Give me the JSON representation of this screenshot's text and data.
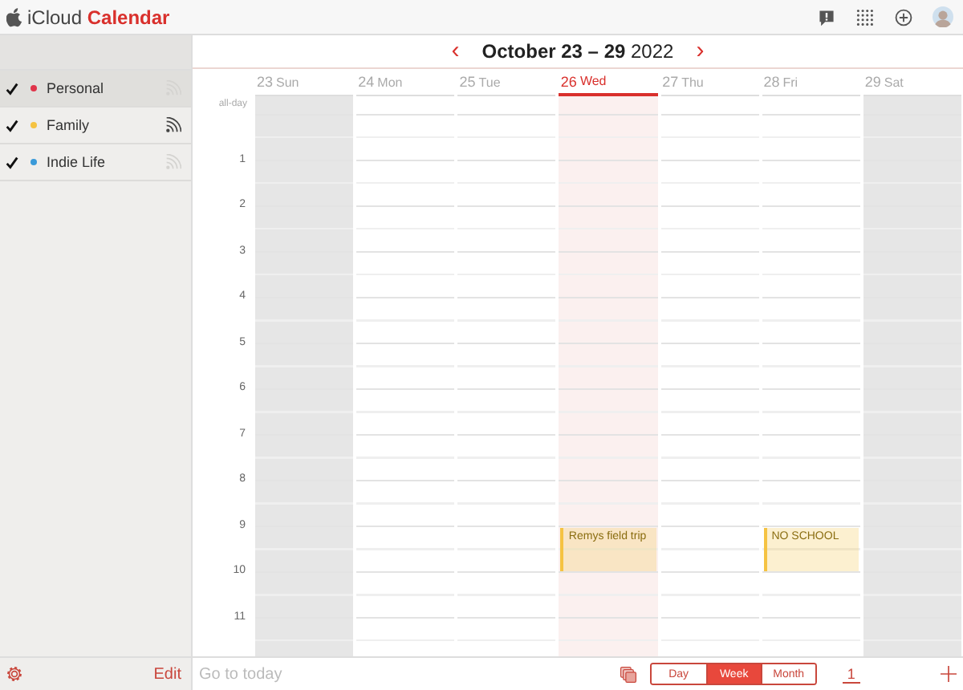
{
  "app": {
    "brand": "iCloud",
    "product": "Calendar"
  },
  "calendars": [
    {
      "name": "Personal",
      "checked": true,
      "selected": true,
      "color": "#e0344a",
      "shared": false
    },
    {
      "name": "Family",
      "checked": true,
      "selected": false,
      "color": "#f5c342",
      "shared": true
    },
    {
      "name": "Indie Life",
      "checked": true,
      "selected": false,
      "color": "#3a9ad9",
      "shared": false
    }
  ],
  "nav": {
    "prev": "‹",
    "title": "**October 23 – 29** 2022",
    "next": "›"
  },
  "all_day_label": "all-day",
  "days": [
    {
      "number": "23",
      "name": "Sun",
      "today": false,
      "weekend": true
    },
    {
      "number": "24",
      "name": "Mon",
      "today": false,
      "weekend": false
    },
    {
      "number": "25",
      "name": "Tue",
      "today": false,
      "weekend": false
    },
    {
      "number": "26",
      "name": "Wed",
      "today": true,
      "weekend": false
    },
    {
      "number": "27",
      "name": "Thu",
      "today": false,
      "weekend": false
    },
    {
      "number": "28",
      "name": "Fri",
      "today": false,
      "weekend": false
    },
    {
      "number": "29",
      "name": "Sat",
      "today": false,
      "weekend": true
    }
  ],
  "hours": [
    {
      "label": "1"
    },
    {
      "label": "2"
    },
    {
      "label": "3"
    },
    {
      "label": "4"
    },
    {
      "label": "5"
    },
    {
      "label": "6"
    },
    {
      "label": "7"
    },
    {
      "label": "8"
    },
    {
      "label": "9",
      "slots": [
        {
          "kind": "empty"
        },
        {
          "kind": "empty"
        },
        {
          "kind": "empty"
        },
        {
          "kind": "event",
          "title": "Remys field trip",
          "color": "#f5c342"
        },
        {
          "kind": "empty"
        },
        {
          "kind": "event",
          "title": "NO SCHOOL",
          "color": "#f5c342"
        },
        {
          "kind": "empty"
        }
      ]
    },
    {
      "label": "10"
    },
    {
      "label": "11"
    }
  ],
  "footer": {
    "edit": "Edit",
    "go_today": {
      "label": "Go to today",
      "disabled": true
    },
    "views": [
      {
        "label": "Day",
        "selected": false
      },
      {
        "label": "Week",
        "selected": true
      },
      {
        "label": "Month",
        "selected": false
      }
    ],
    "inbox_count": "1"
  }
}
